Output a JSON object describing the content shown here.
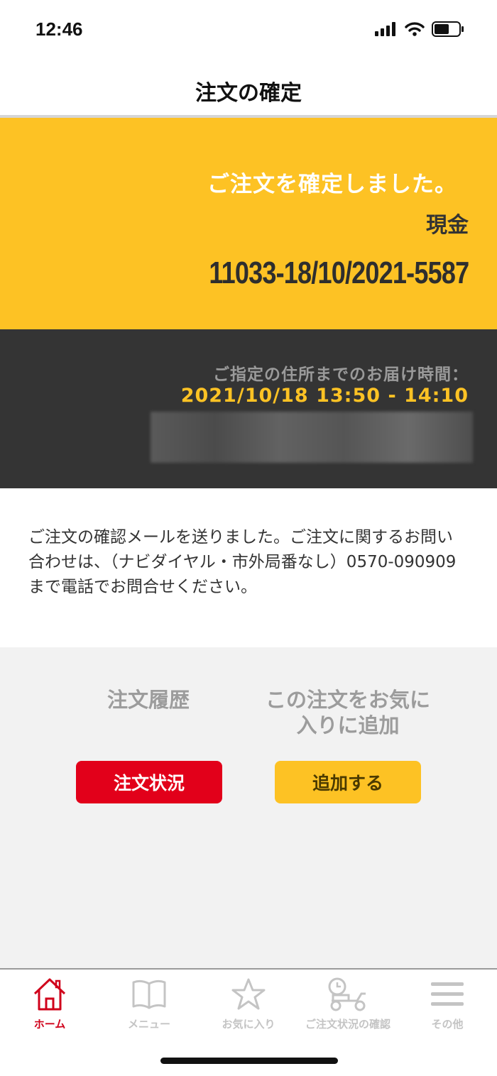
{
  "status_bar": {
    "time": "12:46"
  },
  "header": {
    "title": "注文の確定"
  },
  "confirmation": {
    "message": "ご注文を確定しました。",
    "payment_method": "現金",
    "order_number": "11033-18/10/2021-5587"
  },
  "delivery": {
    "label": "ご指定の住所までのお届け時間：",
    "time": "2021/10/18 13:50 - 14:10"
  },
  "info": {
    "text": "ご注文の確認メールを送りました。ご注文に関するお問い合わせは、（ナビダイヤル・市外局番なし）0570-090909 まで電話でお問合せください。"
  },
  "actions": {
    "history_title": "注文履歴",
    "favorite_title": "この注文をお気に入りに追加",
    "status_button": "注文状況",
    "add_button": "追加する"
  },
  "tabbar": {
    "items": [
      {
        "label": "ホーム",
        "icon": "home-icon",
        "active": true
      },
      {
        "label": "メニュー",
        "icon": "book-icon",
        "active": false
      },
      {
        "label": "お気に入り",
        "icon": "star-icon",
        "active": false
      },
      {
        "label": "ご注文状況の確認",
        "icon": "delivery-scooter-icon",
        "active": false
      },
      {
        "label": "その他",
        "icon": "hamburger-menu-icon",
        "active": false
      }
    ]
  },
  "colors": {
    "accent_yellow": "#fdc224",
    "accent_red": "#e2001a",
    "dark_panel": "#343434",
    "light_gray": "#f2f2f2"
  }
}
